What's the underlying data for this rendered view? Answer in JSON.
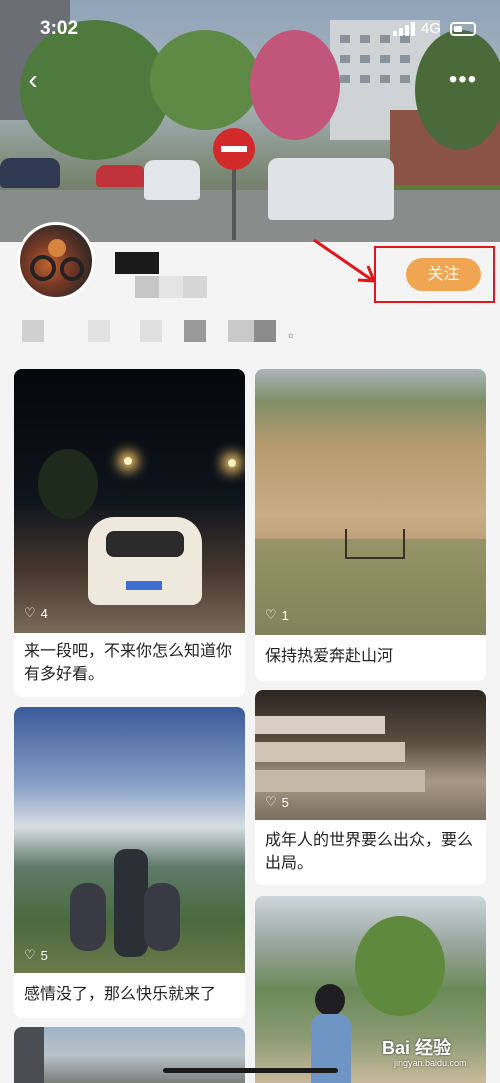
{
  "status_bar": {
    "time": "3:02",
    "network": "4G"
  },
  "header": {
    "back_icon": "chevron-left-icon",
    "more_icon": "more-dots-icon"
  },
  "profile": {
    "follow_label": "关注",
    "desc_suffix": "。"
  },
  "posts": [
    {
      "caption": "来一段吧，不来你怎么知道你有多好看。",
      "likes": "4"
    },
    {
      "caption": "保持热爱奔赴山河",
      "likes": "1"
    },
    {
      "caption": "感情没了，那么快乐就来了",
      "likes": "5"
    },
    {
      "caption": "成年人的世界要么出众，要么出局。",
      "likes": "5"
    }
  ],
  "watermark": {
    "brand": "Bai 经验",
    "url": "jingyan.baidu.com"
  },
  "colors": {
    "follow_button": "#f0a552",
    "highlight_box": "#e0161b",
    "background": "#f4f4f4"
  }
}
